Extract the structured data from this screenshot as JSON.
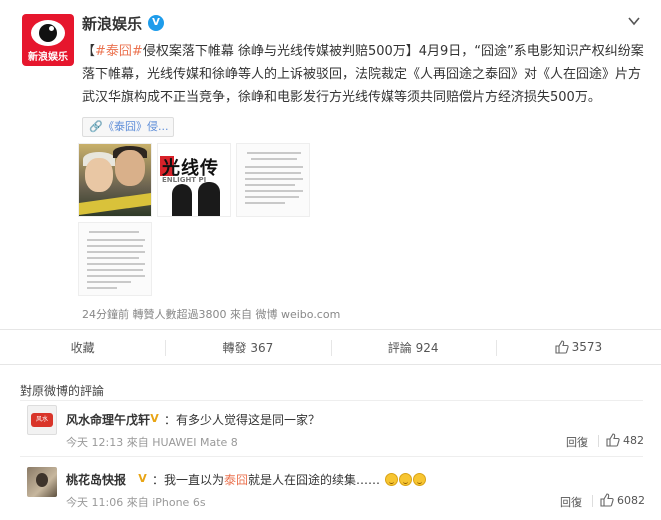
{
  "post": {
    "username": "新浪娱乐",
    "avatar_text": "新浪娱乐",
    "verified_mark": "V",
    "text_open": "【",
    "text_tag": "#泰囧#",
    "text_headline": "侵权案落下帷幕 徐峥与光线传媒被判赔500万】4月9日，“囧途”系电影知识产权纠纷案落下帷幕，光线传媒和徐峥等人的上诉被驳回，法院裁定《人再囧途之泰囧》对《人在囧途》片方武汉华旗构成不正当竞争，徐峥和电影发行方光线传媒等须共同赔偿片方经济损失500万。",
    "link_card_text": "《泰囧》侵...",
    "photo2_text": "光线传",
    "photo2_en": "ENLIGHT PI",
    "meta": "24分鐘前 轉贊人數超過3800 來自 微博 weibo.com"
  },
  "actions": {
    "favorite": "收藏",
    "repost": "轉發 367",
    "comment": "評論 924",
    "like": "3573"
  },
  "comments": {
    "title": "對原微博的評論",
    "items": [
      {
        "name": "风水命理午戊轩",
        "badge": "V",
        "avatar_text": "风水",
        "text_prefix": "：有多少人觉得这是同一家？",
        "highlight": "",
        "text_suffix": "",
        "meta": "今天 12:13 來自 HUAWEI Mate 8",
        "reply": "回復",
        "likes": "482"
      },
      {
        "name": "桃花岛快报",
        "badge": "V",
        "text_prefix": "：我一直以为",
        "highlight": "泰囧",
        "text_suffix": "就是人在囧途的续集……",
        "meta": "今天 11:06 來自 iPhone 6s",
        "reply": "回復",
        "likes": "6082"
      }
    ]
  },
  "colors": {
    "accent": "#eb7350",
    "brand_red": "#e6162d",
    "verified_blue": "#1e9ceb",
    "vip_gold": "#e8a414"
  },
  "icons": {
    "chevron": "chevron-down-icon",
    "link": "link-icon",
    "like": "thumbs-up-icon",
    "emoji": "laughing-emoji-icon"
  }
}
